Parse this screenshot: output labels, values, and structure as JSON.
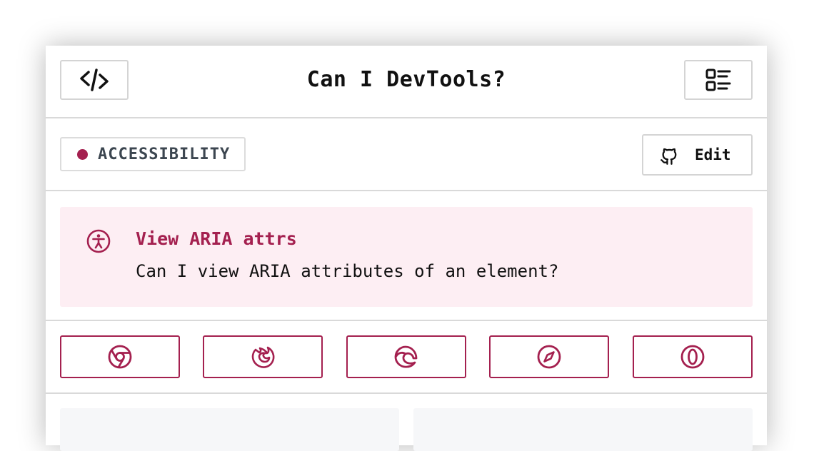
{
  "header": {
    "title": "Can I DevTools?",
    "left_icon": "code-icon",
    "right_icon": "list-icon"
  },
  "meta": {
    "category_label": "ACCESSIBILITY",
    "category_color": "#a4204f",
    "edit_label": "Edit",
    "edit_icon": "github-icon"
  },
  "feature": {
    "title": "View ARIA attrs",
    "description": "Can I view ARIA attributes of an element?",
    "icon": "accessibility-icon"
  },
  "browsers": [
    {
      "name": "chrome",
      "icon": "chrome-icon"
    },
    {
      "name": "firefox",
      "icon": "firefox-icon"
    },
    {
      "name": "edge",
      "icon": "edge-icon"
    },
    {
      "name": "safari",
      "icon": "safari-icon"
    },
    {
      "name": "opera",
      "icon": "opera-icon"
    }
  ],
  "colors": {
    "accent": "#a4204f",
    "feature_bg": "#fdeef3",
    "border": "#d4d4d4"
  }
}
